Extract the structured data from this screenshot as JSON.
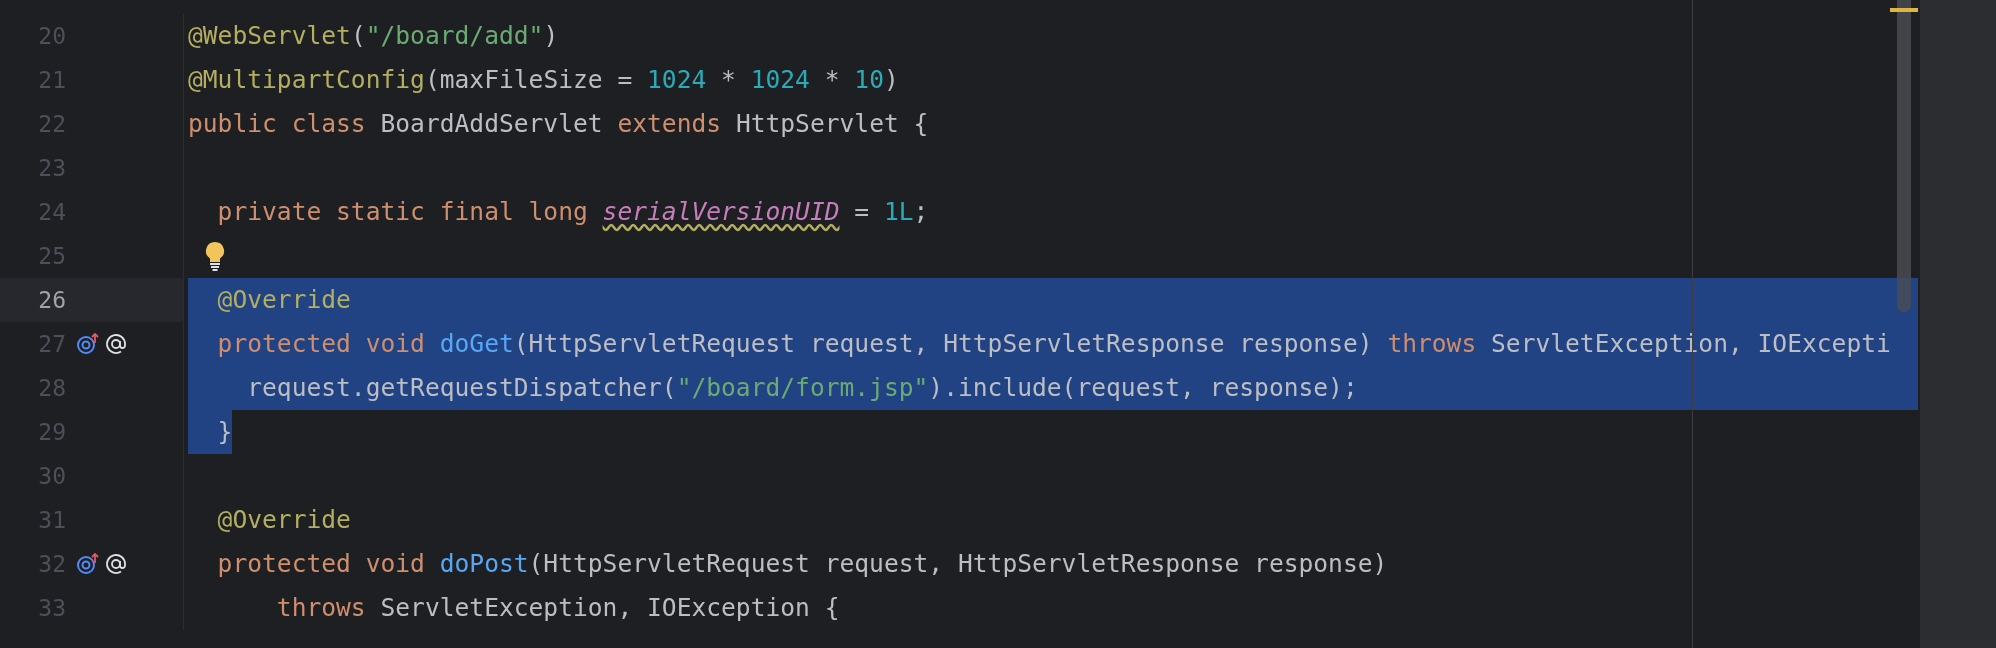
{
  "editor": {
    "lines": [
      {
        "number": "20",
        "current": false,
        "selected": false,
        "markers": false,
        "bulb": false,
        "tokens": [
          {
            "text": "@WebServlet",
            "kind": "annotation"
          },
          {
            "text": "(",
            "kind": "plain"
          },
          {
            "text": "\"/board/add\"",
            "kind": "string"
          },
          {
            "text": ")",
            "kind": "plain"
          }
        ]
      },
      {
        "number": "21",
        "current": false,
        "selected": false,
        "markers": false,
        "bulb": false,
        "tokens": [
          {
            "text": "@MultipartConfig",
            "kind": "annotation"
          },
          {
            "text": "(maxFileSize = ",
            "kind": "plain"
          },
          {
            "text": "1024",
            "kind": "number"
          },
          {
            "text": " * ",
            "kind": "plain"
          },
          {
            "text": "1024",
            "kind": "number"
          },
          {
            "text": " * ",
            "kind": "plain"
          },
          {
            "text": "10",
            "kind": "number"
          },
          {
            "text": ")",
            "kind": "plain"
          }
        ]
      },
      {
        "number": "22",
        "current": false,
        "selected": false,
        "markers": false,
        "bulb": false,
        "tokens": [
          {
            "text": "public class ",
            "kind": "keyword"
          },
          {
            "text": "BoardAddServlet ",
            "kind": "plain"
          },
          {
            "text": "extends ",
            "kind": "keyword"
          },
          {
            "text": "HttpServlet {",
            "kind": "plain"
          }
        ]
      },
      {
        "number": "23",
        "current": false,
        "selected": false,
        "markers": false,
        "bulb": false
      },
      {
        "number": "24",
        "current": false,
        "selected": false,
        "markers": false,
        "bulb": false,
        "tokens": [
          {
            "text": "  private static final long ",
            "kind": "keyword"
          },
          {
            "text": "serialVersionUID",
            "kind": "field_warning"
          },
          {
            "text": " = ",
            "kind": "plain"
          },
          {
            "text": "1L",
            "kind": "number"
          },
          {
            "text": ";",
            "kind": "plain"
          }
        ]
      },
      {
        "number": "25",
        "current": false,
        "selected": false,
        "markers": false,
        "bulb": true
      },
      {
        "number": "26",
        "current": true,
        "selected": true,
        "markers": false,
        "bulb": false,
        "tokens": [
          {
            "text": "  @Override",
            "kind": "annotation"
          }
        ]
      },
      {
        "number": "27",
        "current": false,
        "selected": true,
        "markers": true,
        "bulb": false,
        "tokens": [
          {
            "text": "  protected void ",
            "kind": "keyword"
          },
          {
            "text": "doGet",
            "kind": "method"
          },
          {
            "text": "(HttpServletRequest request, HttpServletResponse response) ",
            "kind": "plain"
          },
          {
            "text": "throws ",
            "kind": "keyword"
          },
          {
            "text": "ServletException, IOExcepti",
            "kind": "plain"
          }
        ]
      },
      {
        "number": "28",
        "current": false,
        "selected": true,
        "markers": false,
        "bulb": false,
        "tokens": [
          {
            "text": "    request.getRequestDispatcher(",
            "kind": "plain"
          },
          {
            "text": "\"/board/form.jsp\"",
            "kind": "string"
          },
          {
            "text": ").include(request, response);",
            "kind": "plain"
          }
        ]
      },
      {
        "number": "29",
        "current": false,
        "selected": true,
        "markers": false,
        "bulb": false,
        "tokens": [
          {
            "text": "  }",
            "kind": "plain"
          }
        ]
      },
      {
        "number": "30",
        "current": false,
        "selected": false,
        "markers": false,
        "bulb": false
      },
      {
        "number": "31",
        "current": false,
        "selected": false,
        "markers": false,
        "bulb": false,
        "tokens": [
          {
            "text": "  @Override",
            "kind": "annotation"
          }
        ]
      },
      {
        "number": "32",
        "current": false,
        "selected": false,
        "markers": true,
        "bulb": false,
        "tokens": [
          {
            "text": "  protected void ",
            "kind": "keyword"
          },
          {
            "text": "doPost",
            "kind": "method"
          },
          {
            "text": "(HttpServletRequest request, HttpServletResponse response)",
            "kind": "plain"
          }
        ]
      },
      {
        "number": "33",
        "current": false,
        "selected": false,
        "markers": false,
        "bulb": false,
        "tokens": [
          {
            "text": "      throws ",
            "kind": "keyword"
          },
          {
            "text": "ServletException, IOException {",
            "kind": "plain"
          }
        ]
      }
    ]
  }
}
